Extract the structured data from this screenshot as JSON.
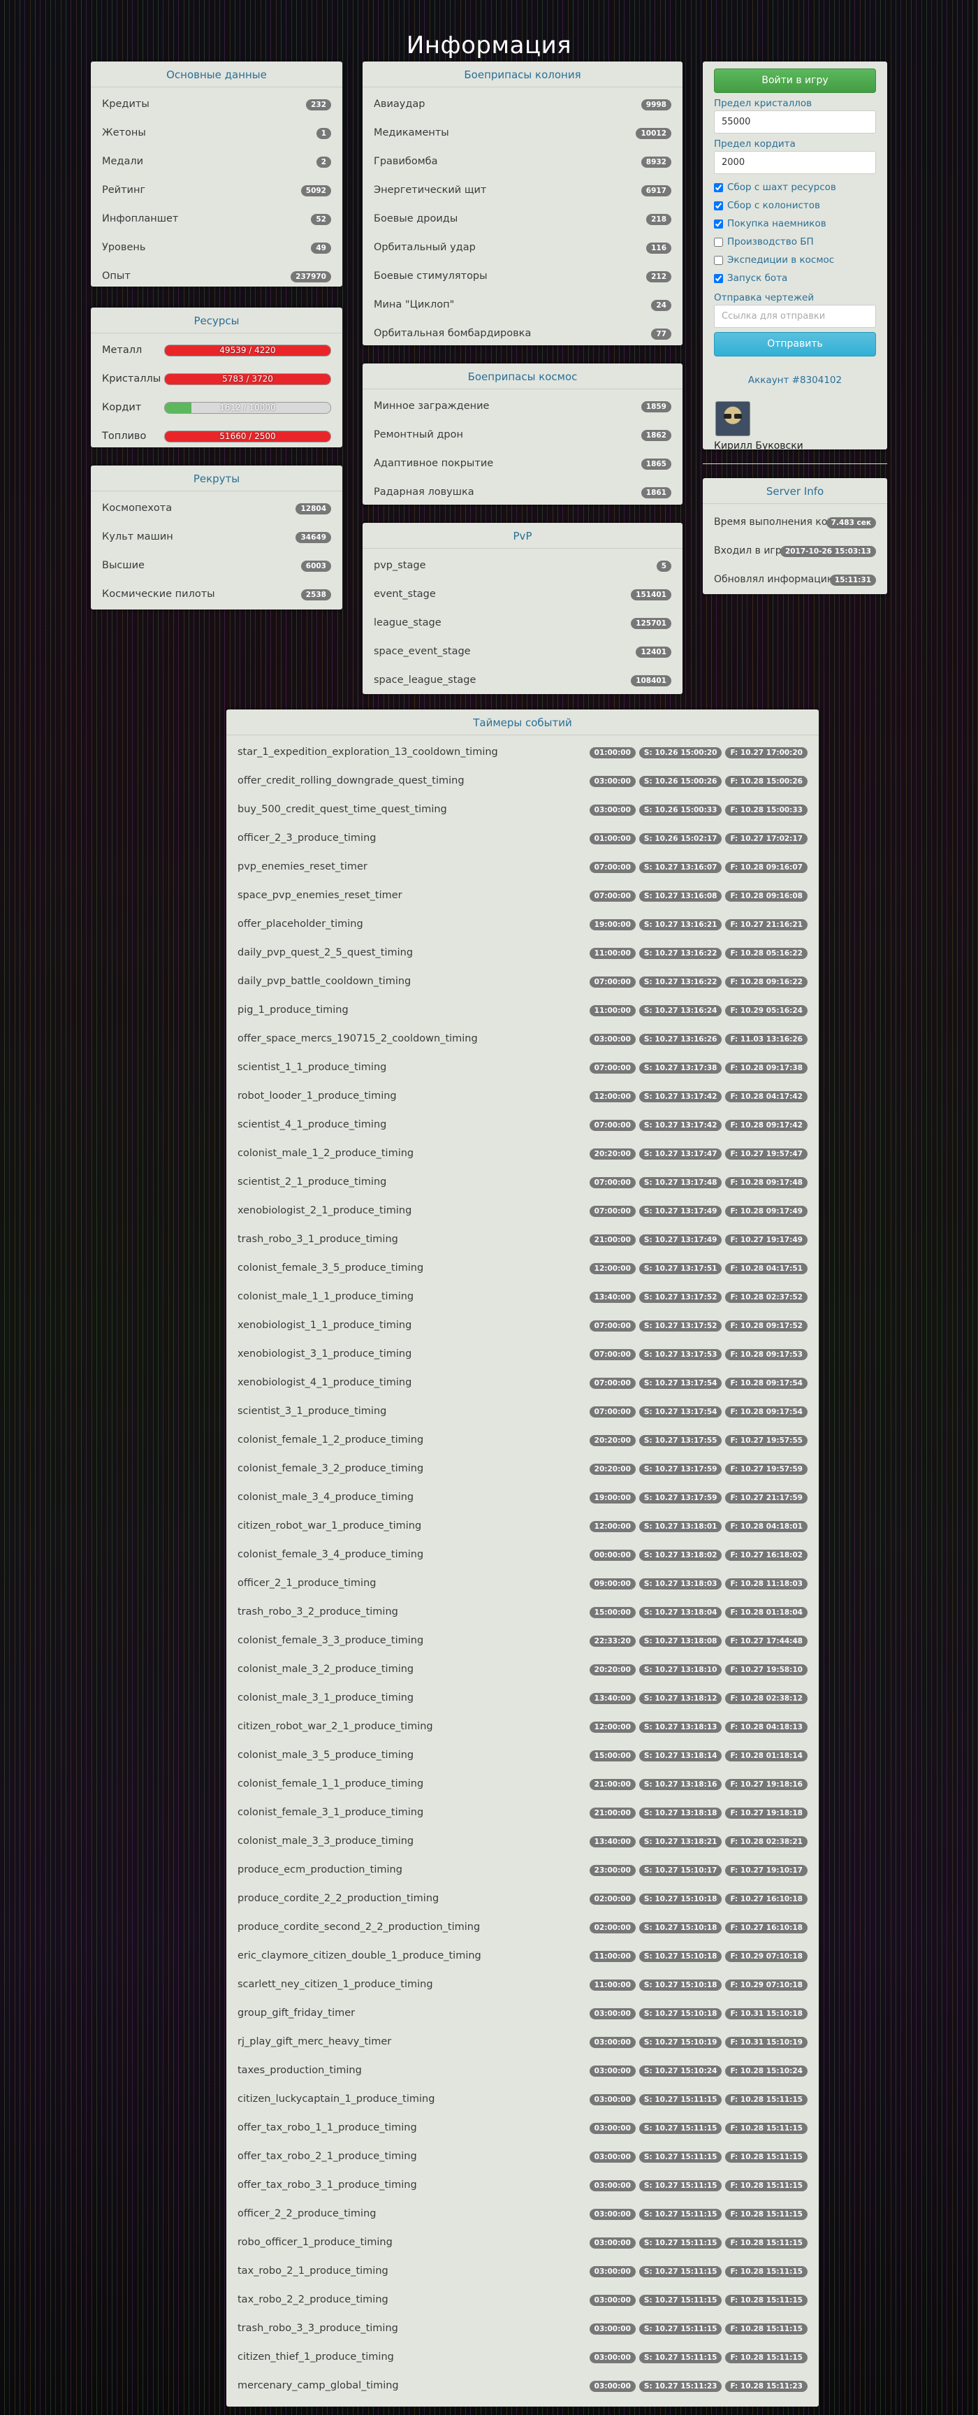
{
  "title": "Информация",
  "basic": {
    "title": "Основные данные",
    "rows": [
      {
        "label": "Кредиты",
        "value": "232"
      },
      {
        "label": "Жетоны",
        "value": "1"
      },
      {
        "label": "Медали",
        "value": "2"
      },
      {
        "label": "Рейтинг",
        "value": "5092"
      },
      {
        "label": "Инфопланшет",
        "value": "52"
      },
      {
        "label": "Уровень",
        "value": "49"
      },
      {
        "label": "Опыт",
        "value": "237970"
      }
    ]
  },
  "resources": {
    "title": "Ресурсы",
    "rows": [
      {
        "label": "Металл",
        "text": "49539 / 4220",
        "fill": 1.0,
        "color": "#e8262a"
      },
      {
        "label": "Кристаллы",
        "text": "5783 / 3720",
        "fill": 1.0,
        "color": "#e8262a"
      },
      {
        "label": "Кордит",
        "text": "1612 / 10000",
        "fill": 0.1612,
        "color": "#5cb85c"
      },
      {
        "label": "Топливо",
        "text": "51660 / 2500",
        "fill": 1.0,
        "color": "#e8262a"
      }
    ]
  },
  "recruits": {
    "title": "Рекруты",
    "rows": [
      {
        "label": "Космопехота",
        "value": "12804"
      },
      {
        "label": "Культ машин",
        "value": "34649"
      },
      {
        "label": "Высшие",
        "value": "6003"
      },
      {
        "label": "Космические пилоты",
        "value": "2538"
      }
    ]
  },
  "colony_ammo": {
    "title": "Боеприпасы колония",
    "rows": [
      {
        "label": "Авиаудар",
        "value": "9998"
      },
      {
        "label": "Медикаменты",
        "value": "10012"
      },
      {
        "label": "Гравибомба",
        "value": "8932"
      },
      {
        "label": "Энергетический щит",
        "value": "6917"
      },
      {
        "label": "Боевые дроиды",
        "value": "218"
      },
      {
        "label": "Орбитальный удар",
        "value": "116"
      },
      {
        "label": "Боевые стимуляторы",
        "value": "212"
      },
      {
        "label": "Мина \"Циклоп\"",
        "value": "24"
      },
      {
        "label": "Орбитальная бомбардировка",
        "value": "77"
      }
    ]
  },
  "space_ammo": {
    "title": "Боеприпасы космос",
    "rows": [
      {
        "label": "Минное заграждение",
        "value": "1859"
      },
      {
        "label": "Ремонтный дрон",
        "value": "1862"
      },
      {
        "label": "Адаптивное покрытие",
        "value": "1865"
      },
      {
        "label": "Радарная ловушка",
        "value": "1861"
      }
    ]
  },
  "pvp": {
    "title": "PvP",
    "rows": [
      {
        "label": "pvp_stage",
        "value": "5"
      },
      {
        "label": "event_stage",
        "value": "151401"
      },
      {
        "label": "league_stage",
        "value": "125701"
      },
      {
        "label": "space_event_stage",
        "value": "12401"
      },
      {
        "label": "space_league_stage",
        "value": "108401"
      }
    ]
  },
  "control": {
    "login_button": "Войти в игру",
    "crystal_limit_label": "Предел кристаллов",
    "crystal_limit_value": "55000",
    "cordite_limit_label": "Предел кордита",
    "cordite_limit_value": "2000",
    "checkboxes": [
      {
        "label": "Сбор с шахт ресурсов",
        "checked": true
      },
      {
        "label": "Сбор с колонистов",
        "checked": true
      },
      {
        "label": "Покупка наемников",
        "checked": true
      },
      {
        "label": "Производство БП",
        "checked": false
      },
      {
        "label": "Экспедиции в космос",
        "checked": false
      },
      {
        "label": "Запуск бота",
        "checked": true
      }
    ],
    "blueprint_label": "Отправка чертежей",
    "blueprint_placeholder": "Ссылка для отправки",
    "send_button": "Отправить",
    "account_link": "Аккаунт #8304102",
    "user_name": "Кирилл Буковски"
  },
  "server_info": {
    "title": "Server Info",
    "rows": [
      {
        "label": "Время выполнения кода",
        "value": "7.483 сек"
      },
      {
        "label": "Входил в игру",
        "value": "2017-10-26 15:03:13"
      },
      {
        "label": "Обновлял информацию",
        "value": "15:11:31"
      }
    ]
  },
  "timers": {
    "title": "Таймеры событий",
    "rows": [
      {
        "name": "star_1_expedition_exploration_13_cooldown_timing",
        "d": "01:00:00",
        "s": "S: 10.26 15:00:20",
        "f": "F: 10.27 17:00:20"
      },
      {
        "name": "offer_credit_rolling_downgrade_quest_timing",
        "d": "03:00:00",
        "s": "S: 10.26 15:00:26",
        "f": "F: 10.28 15:00:26"
      },
      {
        "name": "buy_500_credit_quest_time_quest_timing",
        "d": "03:00:00",
        "s": "S: 10.26 15:00:33",
        "f": "F: 10.28 15:00:33"
      },
      {
        "name": "officer_2_3_produce_timing",
        "d": "01:00:00",
        "s": "S: 10.26 15:02:17",
        "f": "F: 10.27 17:02:17"
      },
      {
        "name": "pvp_enemies_reset_timer",
        "d": "07:00:00",
        "s": "S: 10.27 13:16:07",
        "f": "F: 10.28 09:16:07"
      },
      {
        "name": "space_pvp_enemies_reset_timer",
        "d": "07:00:00",
        "s": "S: 10.27 13:16:08",
        "f": "F: 10.28 09:16:08"
      },
      {
        "name": "offer_placeholder_timing",
        "d": "19:00:00",
        "s": "S: 10.27 13:16:21",
        "f": "F: 10.27 21:16:21"
      },
      {
        "name": "daily_pvp_quest_2_5_quest_timing",
        "d": "11:00:00",
        "s": "S: 10.27 13:16:22",
        "f": "F: 10.28 05:16:22"
      },
      {
        "name": "daily_pvp_battle_cooldown_timing",
        "d": "07:00:00",
        "s": "S: 10.27 13:16:22",
        "f": "F: 10.28 09:16:22"
      },
      {
        "name": "pig_1_produce_timing",
        "d": "11:00:00",
        "s": "S: 10.27 13:16:24",
        "f": "F: 10.29 05:16:24"
      },
      {
        "name": "offer_space_mercs_190715_2_cooldown_timing",
        "d": "03:00:00",
        "s": "S: 10.27 13:16:26",
        "f": "F: 11.03 13:16:26"
      },
      {
        "name": "scientist_1_1_produce_timing",
        "d": "07:00:00",
        "s": "S: 10.27 13:17:38",
        "f": "F: 10.28 09:17:38"
      },
      {
        "name": "robot_looder_1_produce_timing",
        "d": "12:00:00",
        "s": "S: 10.27 13:17:42",
        "f": "F: 10.28 04:17:42"
      },
      {
        "name": "scientist_4_1_produce_timing",
        "d": "07:00:00",
        "s": "S: 10.27 13:17:42",
        "f": "F: 10.28 09:17:42"
      },
      {
        "name": "colonist_male_1_2_produce_timing",
        "d": "20:20:00",
        "s": "S: 10.27 13:17:47",
        "f": "F: 10.27 19:57:47"
      },
      {
        "name": "scientist_2_1_produce_timing",
        "d": "07:00:00",
        "s": "S: 10.27 13:17:48",
        "f": "F: 10.28 09:17:48"
      },
      {
        "name": "xenobiologist_2_1_produce_timing",
        "d": "07:00:00",
        "s": "S: 10.27 13:17:49",
        "f": "F: 10.28 09:17:49"
      },
      {
        "name": "trash_robo_3_1_produce_timing",
        "d": "21:00:00",
        "s": "S: 10.27 13:17:49",
        "f": "F: 10.27 19:17:49"
      },
      {
        "name": "colonist_female_3_5_produce_timing",
        "d": "12:00:00",
        "s": "S: 10.27 13:17:51",
        "f": "F: 10.28 04:17:51"
      },
      {
        "name": "colonist_male_1_1_produce_timing",
        "d": "13:40:00",
        "s": "S: 10.27 13:17:52",
        "f": "F: 10.28 02:37:52"
      },
      {
        "name": "xenobiologist_1_1_produce_timing",
        "d": "07:00:00",
        "s": "S: 10.27 13:17:52",
        "f": "F: 10.28 09:17:52"
      },
      {
        "name": "xenobiologist_3_1_produce_timing",
        "d": "07:00:00",
        "s": "S: 10.27 13:17:53",
        "f": "F: 10.28 09:17:53"
      },
      {
        "name": "xenobiologist_4_1_produce_timing",
        "d": "07:00:00",
        "s": "S: 10.27 13:17:54",
        "f": "F: 10.28 09:17:54"
      },
      {
        "name": "scientist_3_1_produce_timing",
        "d": "07:00:00",
        "s": "S: 10.27 13:17:54",
        "f": "F: 10.28 09:17:54"
      },
      {
        "name": "colonist_female_1_2_produce_timing",
        "d": "20:20:00",
        "s": "S: 10.27 13:17:55",
        "f": "F: 10.27 19:57:55"
      },
      {
        "name": "colonist_female_3_2_produce_timing",
        "d": "20:20:00",
        "s": "S: 10.27 13:17:59",
        "f": "F: 10.27 19:57:59"
      },
      {
        "name": "colonist_male_3_4_produce_timing",
        "d": "19:00:00",
        "s": "S: 10.27 13:17:59",
        "f": "F: 10.27 21:17:59"
      },
      {
        "name": "citizen_robot_war_1_produce_timing",
        "d": "12:00:00",
        "s": "S: 10.27 13:18:01",
        "f": "F: 10.28 04:18:01"
      },
      {
        "name": "colonist_female_3_4_produce_timing",
        "d": "00:00:00",
        "s": "S: 10.27 13:18:02",
        "f": "F: 10.27 16:18:02"
      },
      {
        "name": "officer_2_1_produce_timing",
        "d": "09:00:00",
        "s": "S: 10.27 13:18:03",
        "f": "F: 10.28 11:18:03"
      },
      {
        "name": "trash_robo_3_2_produce_timing",
        "d": "15:00:00",
        "s": "S: 10.27 13:18:04",
        "f": "F: 10.28 01:18:04"
      },
      {
        "name": "colonist_female_3_3_produce_timing",
        "d": "22:33:20",
        "s": "S: 10.27 13:18:08",
        "f": "F: 10.27 17:44:48"
      },
      {
        "name": "colonist_male_3_2_produce_timing",
        "d": "20:20:00",
        "s": "S: 10.27 13:18:10",
        "f": "F: 10.27 19:58:10"
      },
      {
        "name": "colonist_male_3_1_produce_timing",
        "d": "13:40:00",
        "s": "S: 10.27 13:18:12",
        "f": "F: 10.28 02:38:12"
      },
      {
        "name": "citizen_robot_war_2_1_produce_timing",
        "d": "12:00:00",
        "s": "S: 10.27 13:18:13",
        "f": "F: 10.28 04:18:13"
      },
      {
        "name": "colonist_male_3_5_produce_timing",
        "d": "15:00:00",
        "s": "S: 10.27 13:18:14",
        "f": "F: 10.28 01:18:14"
      },
      {
        "name": "colonist_female_1_1_produce_timing",
        "d": "21:00:00",
        "s": "S: 10.27 13:18:16",
        "f": "F: 10.27 19:18:16"
      },
      {
        "name": "colonist_female_3_1_produce_timing",
        "d": "21:00:00",
        "s": "S: 10.27 13:18:18",
        "f": "F: 10.27 19:18:18"
      },
      {
        "name": "colonist_male_3_3_produce_timing",
        "d": "13:40:00",
        "s": "S: 10.27 13:18:21",
        "f": "F: 10.28 02:38:21"
      },
      {
        "name": "produce_ecm_production_timing",
        "d": "23:00:00",
        "s": "S: 10.27 15:10:17",
        "f": "F: 10.27 19:10:17"
      },
      {
        "name": "produce_cordite_2_2_production_timing",
        "d": "02:00:00",
        "s": "S: 10.27 15:10:18",
        "f": "F: 10.27 16:10:18"
      },
      {
        "name": "produce_cordite_second_2_2_production_timing",
        "d": "02:00:00",
        "s": "S: 10.27 15:10:18",
        "f": "F: 10.27 16:10:18"
      },
      {
        "name": "eric_claymore_citizen_double_1_produce_timing",
        "d": "11:00:00",
        "s": "S: 10.27 15:10:18",
        "f": "F: 10.29 07:10:18"
      },
      {
        "name": "scarlett_ney_citizen_1_produce_timing",
        "d": "11:00:00",
        "s": "S: 10.27 15:10:18",
        "f": "F: 10.29 07:10:18"
      },
      {
        "name": "group_gift_friday_timer",
        "d": "03:00:00",
        "s": "S: 10.27 15:10:18",
        "f": "F: 10.31 15:10:18"
      },
      {
        "name": "rj_play_gift_merc_heavy_timer",
        "d": "03:00:00",
        "s": "S: 10.27 15:10:19",
        "f": "F: 10.31 15:10:19"
      },
      {
        "name": "taxes_production_timing",
        "d": "03:00:00",
        "s": "S: 10.27 15:10:24",
        "f": "F: 10.28 15:10:24"
      },
      {
        "name": "citizen_luckycaptain_1_produce_timing",
        "d": "03:00:00",
        "s": "S: 10.27 15:11:15",
        "f": "F: 10.28 15:11:15"
      },
      {
        "name": "offer_tax_robo_1_1_produce_timing",
        "d": "03:00:00",
        "s": "S: 10.27 15:11:15",
        "f": "F: 10.28 15:11:15"
      },
      {
        "name": "offer_tax_robo_2_1_produce_timing",
        "d": "03:00:00",
        "s": "S: 10.27 15:11:15",
        "f": "F: 10.28 15:11:15"
      },
      {
        "name": "offer_tax_robo_3_1_produce_timing",
        "d": "03:00:00",
        "s": "S: 10.27 15:11:15",
        "f": "F: 10.28 15:11:15"
      },
      {
        "name": "officer_2_2_produce_timing",
        "d": "03:00:00",
        "s": "S: 10.27 15:11:15",
        "f": "F: 10.28 15:11:15"
      },
      {
        "name": "robo_officer_1_produce_timing",
        "d": "03:00:00",
        "s": "S: 10.27 15:11:15",
        "f": "F: 10.28 15:11:15"
      },
      {
        "name": "tax_robo_2_1_produce_timing",
        "d": "03:00:00",
        "s": "S: 10.27 15:11:15",
        "f": "F: 10.28 15:11:15"
      },
      {
        "name": "tax_robo_2_2_produce_timing",
        "d": "03:00:00",
        "s": "S: 10.27 15:11:15",
        "f": "F: 10.28 15:11:15"
      },
      {
        "name": "trash_robo_3_3_produce_timing",
        "d": "03:00:00",
        "s": "S: 10.27 15:11:15",
        "f": "F: 10.28 15:11:15"
      },
      {
        "name": "citizen_thief_1_produce_timing",
        "d": "03:00:00",
        "s": "S: 10.27 15:11:15",
        "f": "F: 10.28 15:11:15"
      },
      {
        "name": "mercenary_camp_global_timing",
        "d": "03:00:00",
        "s": "S: 10.27 15:11:23",
        "f": "F: 10.28 15:11:23"
      }
    ]
  }
}
